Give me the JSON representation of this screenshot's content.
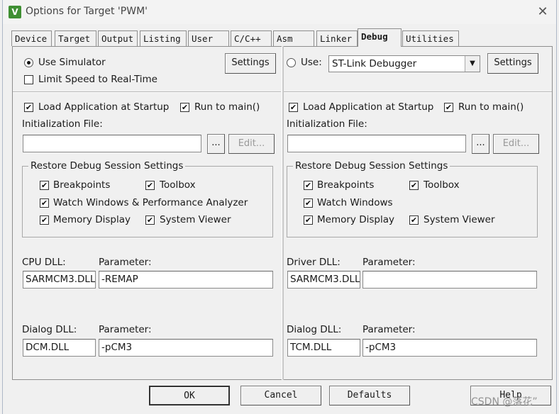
{
  "window": {
    "title": "Options for Target 'PWM'",
    "icon_letter": "V"
  },
  "tabs": [
    "Device",
    "Target",
    "Output",
    "Listing",
    "User",
    "C/C++",
    "Asm",
    "Linker",
    "Debug",
    "Utilities"
  ],
  "active_tab": "Debug",
  "left": {
    "use_simulator": {
      "label": "Use Simulator",
      "checked": true
    },
    "limit_speed": {
      "label": "Limit Speed to Real-Time",
      "checked": false
    },
    "settings_label": "Settings",
    "load_app": {
      "label": "Load Application at Startup",
      "checked": true
    },
    "run_to_main": {
      "label": "Run to main()",
      "checked": true
    },
    "init_file_label": "Initialization File:",
    "init_file_value": "",
    "browse_label": "...",
    "edit_label": "Edit...",
    "restore_title": "Restore Debug Session Settings",
    "breakpoints": {
      "label": "Breakpoints",
      "checked": true
    },
    "toolbox": {
      "label": "Toolbox",
      "checked": true
    },
    "watch_windows": {
      "label": "Watch Windows & Performance Analyzer",
      "checked": true
    },
    "memory_display": {
      "label": "Memory Display",
      "checked": true
    },
    "system_viewer": {
      "label": "System Viewer",
      "checked": true
    },
    "cpu_dll_label": "CPU DLL:",
    "cpu_param_label": "Parameter:",
    "cpu_dll_value": "SARMCM3.DLL",
    "cpu_param_value": "-REMAP",
    "dialog_dll_label": "Dialog DLL:",
    "dialog_param_label": "Parameter:",
    "dialog_dll_value": "DCM.DLL",
    "dialog_param_value": "-pCM3"
  },
  "right": {
    "use": {
      "label": "Use:",
      "checked": false
    },
    "debugger_value": "ST-Link Debugger",
    "settings_label": "Settings",
    "load_app": {
      "label": "Load Application at Startup",
      "checked": true
    },
    "run_to_main": {
      "label": "Run to main()",
      "checked": true
    },
    "init_file_label": "Initialization File:",
    "init_file_value": "",
    "browse_label": "...",
    "edit_label": "Edit...",
    "restore_title": "Restore Debug Session Settings",
    "breakpoints": {
      "label": "Breakpoints",
      "checked": true
    },
    "toolbox": {
      "label": "Toolbox",
      "checked": true
    },
    "watch_windows": {
      "label": "Watch Windows",
      "checked": true
    },
    "memory_display": {
      "label": "Memory Display",
      "checked": true
    },
    "system_viewer": {
      "label": "System Viewer",
      "checked": true
    },
    "driver_dll_label": "Driver DLL:",
    "driver_param_label": "Parameter:",
    "driver_dll_value": "SARMCM3.DLL",
    "driver_param_value": "",
    "dialog_dll_label": "Dialog DLL:",
    "dialog_param_label": "Parameter:",
    "dialog_dll_value": "TCM.DLL",
    "dialog_param_value": "-pCM3"
  },
  "footer": {
    "ok": "OK",
    "cancel": "Cancel",
    "defaults": "Defaults",
    "help": "Help"
  },
  "watermark": "CSDN @落花”"
}
